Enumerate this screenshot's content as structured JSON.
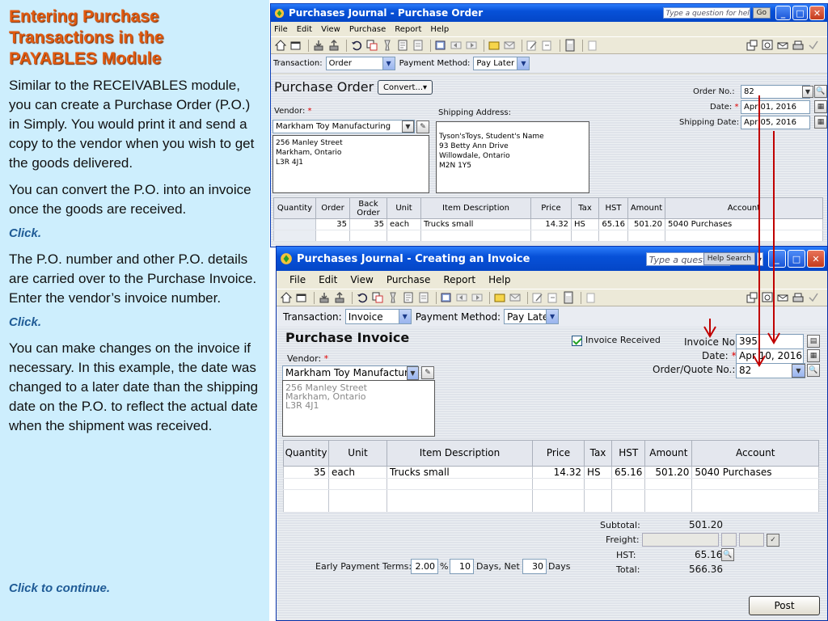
{
  "slide": {
    "title_line1": "Entering Purchase",
    "title_line2": "Transactions in the",
    "title_line3": "PAYABLES Module",
    "para1": "Similar to the RECEIVABLES module, you can create a Purchase Order (P.O.) in Simply. You would print it and send a copy to the vendor when you wish to get the goods delivered.",
    "para2": "You can convert the P.O. into an invoice once the goods are received.",
    "click1": "Click.",
    "para3": "The P.O. number and other P.O. details are carried over to the Purchase Invoice.  Enter the vendor’s invoice number.",
    "click2": "Click.",
    "para4": "You can make changes on the invoice if necessary. In this example, the date was changed to a later date than the shipping date on the P.O. to reflect the actual date when the shipment was received.",
    "continue": "Click to continue."
  },
  "po_window": {
    "title": "Purchases Journal - Purchase Order",
    "help_placeholder": "Type a question for help",
    "go_label": "Go",
    "menu": [
      "File",
      "Edit",
      "View",
      "Purchase",
      "Report",
      "Help"
    ],
    "transaction_label": "Transaction:",
    "transaction_value": "Order",
    "payment_method_label": "Payment Method:",
    "payment_method_value": "Pay Later",
    "form_title": "Purchase Order",
    "convert_label": "Convert...",
    "order_no_label": "Order No.:",
    "order_no_value": "82",
    "date_label": "Date:",
    "date_value": "Apr 01, 2016",
    "shipping_date_label": "Shipping Date:",
    "shipping_date_value": "Apr 05, 2016",
    "vendor_label": "Vendor:",
    "vendor_value": "Markham Toy Manufacturing",
    "vendor_address": [
      "256 Manley Street",
      "Markham, Ontario",
      "L3R 4J1"
    ],
    "shipping_label": "Shipping Address:",
    "shipping_address": [
      "Tyson'sToys, Student's Name",
      "93 Betty Ann Drive",
      "Willowdale, Ontario",
      "M2N 1Y5"
    ],
    "columns": [
      "Quantity",
      "Order",
      "Back Order",
      "Unit",
      "Item Description",
      "Price",
      "Tax",
      "HST",
      "Amount",
      "Account"
    ],
    "row": [
      "",
      "35",
      "35",
      "each",
      "Trucks small",
      "14.32",
      "HS",
      "65.16",
      "501.20",
      "5040 Purchases"
    ]
  },
  "inv_window": {
    "title": "Purchases Journal - Creating an Invoice",
    "help_placeholder": "Type a question fo",
    "help_search_label": "Help Search",
    "menu": [
      "File",
      "Edit",
      "View",
      "Purchase",
      "Report",
      "Help"
    ],
    "transaction_label": "Transaction:",
    "transaction_value": "Invoice",
    "payment_method_label": "Payment Method:",
    "payment_method_value": "Pay Late",
    "form_title": "Purchase Invoice",
    "invoice_received_label": "Invoice Received",
    "invoice_no_label": "Invoice No.:",
    "invoice_no_value": "395",
    "date_label": "Date:",
    "date_value": "Apr 10, 2016",
    "order_quote_label": "Order/Quote No.:",
    "order_quote_value": "82",
    "vendor_label": "Vendor:",
    "vendor_value": "Markham Toy Manufacturing",
    "vendor_address": [
      "256 Manley Street",
      "Markham, Ontario",
      "L3R 4J1"
    ],
    "columns": [
      "Quantity",
      "Unit",
      "Item Description",
      "Price",
      "Tax",
      "HST",
      "Amount",
      "Account"
    ],
    "row": [
      "35",
      "each",
      "Trucks small",
      "14.32",
      "HS",
      "65.16",
      "501.20",
      "5040 Purchases"
    ],
    "subtotal_label": "Subtotal:",
    "subtotal_value": "501.20",
    "freight_label": "Freight:",
    "hst_label": "HST:",
    "hst_value": "65.16",
    "total_label": "Total:",
    "total_value": "566.36",
    "early_terms_label": "Early Payment Terms:",
    "early_pct": "2.00",
    "pct_sign": "%",
    "early_days": "10",
    "days_net_label": "Days,  Net",
    "net_days": "30",
    "days_label": "Days",
    "post_label": "Post"
  },
  "colors": {
    "slide_bg": "#cdeefd",
    "title_orange": "#e05a10",
    "click_blue": "#1f5b96",
    "arrow_red": "#c00000",
    "xp_blue": "#0751d8"
  }
}
